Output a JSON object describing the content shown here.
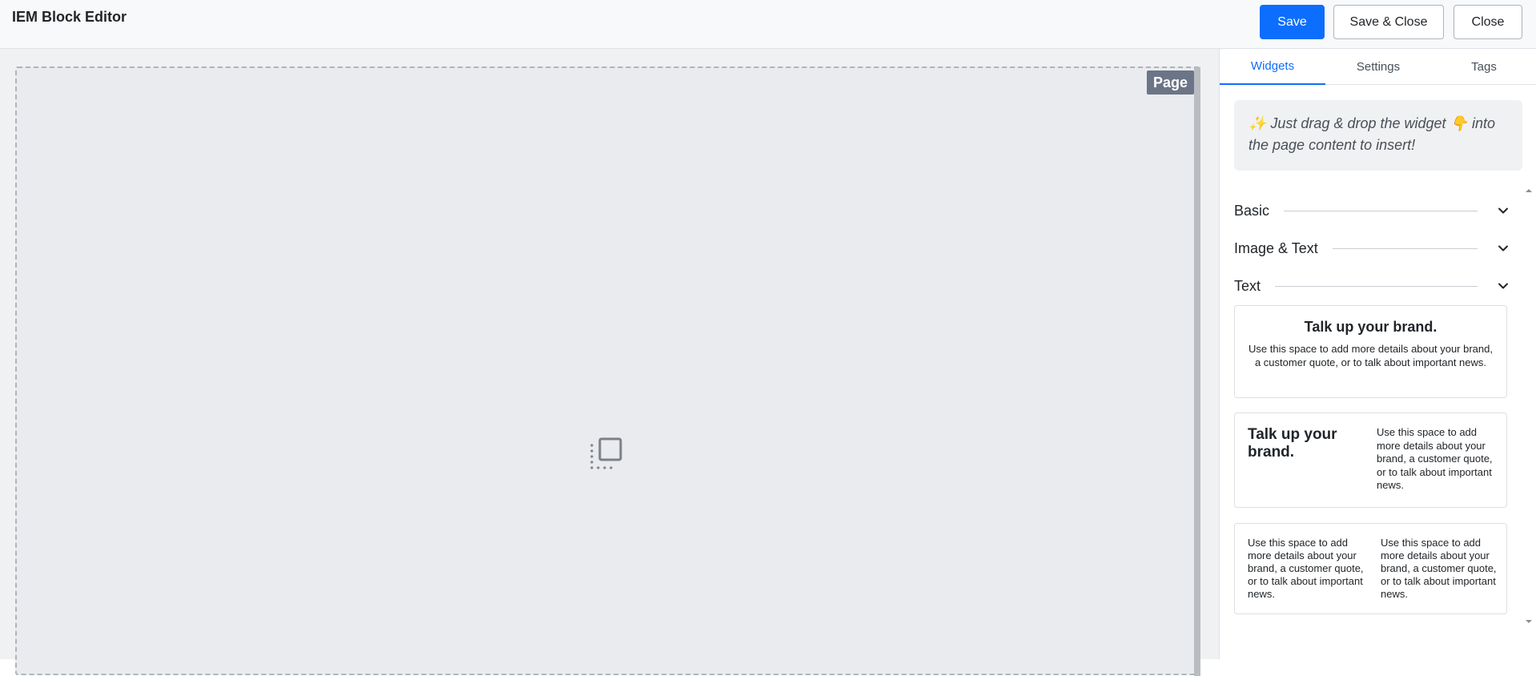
{
  "header": {
    "title": "IEM Block Editor",
    "save_label": "Save",
    "save_close_label": "Save & Close",
    "close_label": "Close"
  },
  "canvas": {
    "page_badge": "Page",
    "placeholder_icon": "drop-zone-icon"
  },
  "sidebar": {
    "tabs": [
      {
        "label": "Widgets",
        "active": true
      },
      {
        "label": "Settings",
        "active": false
      },
      {
        "label": "Tags",
        "active": false
      }
    ],
    "hint": "✨ Just drag & drop the widget 👇 into the page content to insert!",
    "categories": [
      {
        "label": "Basic",
        "icon": "chevron-down-icon"
      },
      {
        "label": "Image & Text",
        "icon": "chevron-down-icon"
      },
      {
        "label": "Text",
        "icon": "chevron-down-icon"
      }
    ],
    "widgets": {
      "centered": {
        "title": "Talk up your brand.",
        "body": "Use this space to add more details about your brand, a customer quote, or to talk about important news."
      },
      "two_column_title": {
        "title": "Talk up your brand.",
        "body": "Use this space to add more details about your brand, a customer quote, or to talk about important news."
      },
      "two_column_text": {
        "col1": "Use this space to add more details about your brand, a customer quote, or to talk about important news.",
        "col2": "Use this space to add more details about your brand, a customer quote, or to talk about important news."
      }
    }
  },
  "colors": {
    "primary": "#0d6efd",
    "badge": "#6c7587",
    "canvas": "#e9ebee"
  }
}
